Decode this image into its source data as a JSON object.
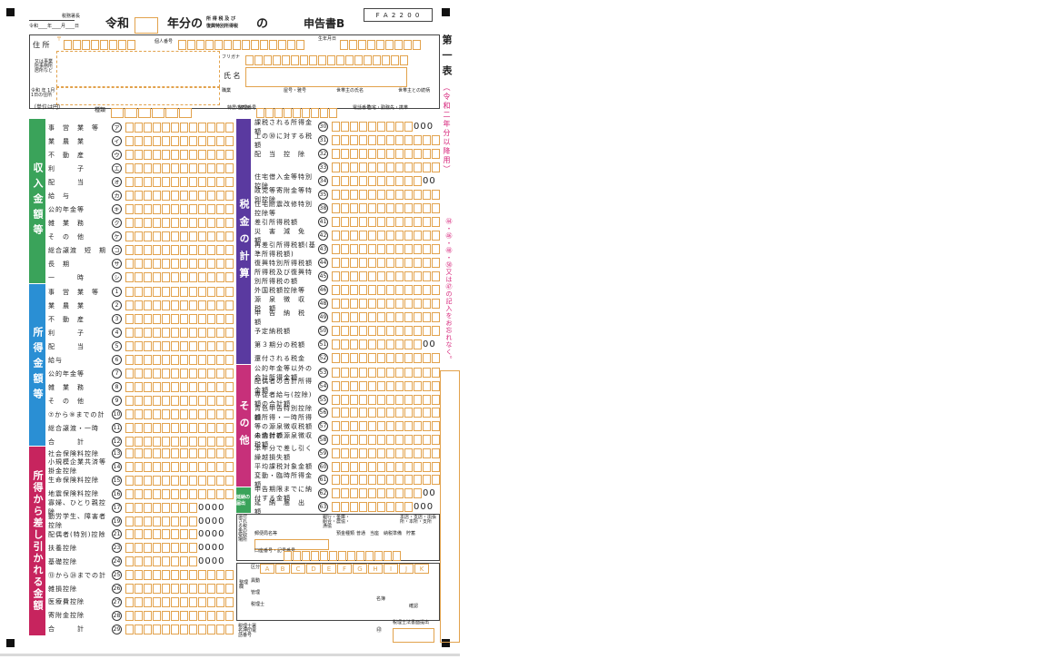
{
  "form": {
    "code_box": "F A 2 2 0 0",
    "tax_office": "税務署長",
    "date_line": "令和____年____月____日",
    "era": "令和",
    "year_suffix": "年分の",
    "tax_kind_line1": "所 得 税 及 び",
    "tax_kind_line2": "復興特別所得税",
    "no": "の",
    "title": "申告書B",
    "side_title": "第一表",
    "side_note": "（令和二年分以降用）",
    "side_warning": "㊹・㊻・㊽・㊿又は㊼の記入をお忘れなく。"
  },
  "header": {
    "address": "住 所",
    "zip_mark": "〒",
    "personal_no": "個人番号",
    "birth": "生年月日",
    "kana": "フリガナ",
    "name": "氏 名",
    "alt_address": "又は事業所事務所居所など",
    "jan1_address": "令和 年 1月1日の住所",
    "occupation": "職業",
    "trade_name": "屋号・雅号",
    "head_name": "世帯主の氏名",
    "relation": "世帯主との続柄",
    "unit": "（単位は円）",
    "kind": "種類",
    "special": "特農の表示",
    "seiri": "整理番号",
    "phone": "電話番号",
    "phone_kind": "自宅・勤務先・携帯"
  },
  "bands": {
    "income_revenue": "収入金額等",
    "income_amount": "所得金額等",
    "deductions": "所得から差し引かれる金額",
    "tax_calc": "税金の計算",
    "other": "その他",
    "extension": "延納の届出"
  },
  "revenue_rows": [
    {
      "label": "事　営　業　等",
      "num": "ア"
    },
    {
      "label": "業　農　業",
      "num": "イ"
    },
    {
      "label": "不　動　産",
      "num": "ウ"
    },
    {
      "label": "利　　　子",
      "num": "エ"
    },
    {
      "label": "配　　　当",
      "num": "オ"
    },
    {
      "label": "給　与",
      "num": "カ"
    },
    {
      "label": "公的年金等",
      "num": "キ"
    },
    {
      "label": "雑　業　務",
      "num": "ク"
    },
    {
      "label": "そ　の　他",
      "num": "ケ"
    },
    {
      "label": "総合譲渡　短　期",
      "num": "コ"
    },
    {
      "label": "長　期",
      "num": "サ"
    },
    {
      "label": "一　　　時",
      "num": "シ"
    }
  ],
  "income_rows": [
    {
      "label": "事　営　業　等",
      "num": "1"
    },
    {
      "label": "業　農　業",
      "num": "2"
    },
    {
      "label": "不　動　産",
      "num": "3"
    },
    {
      "label": "利　　　子",
      "num": "4"
    },
    {
      "label": "配　　　当",
      "num": "5"
    },
    {
      "label": "給与",
      "num": "6"
    },
    {
      "label": "公的年金等",
      "num": "7"
    },
    {
      "label": "雑　業　務",
      "num": "8"
    },
    {
      "label": "そ　の　他",
      "num": "9"
    },
    {
      "label": "⑦から⑨までの計",
      "num": "10"
    },
    {
      "label": "総合譲渡・一時",
      "num": "11"
    },
    {
      "label": "合　　　計",
      "num": "12"
    }
  ],
  "deduction_rows": [
    {
      "label": "社会保険料控除",
      "num": "13",
      "zeros": ""
    },
    {
      "label": "小規模企業共済等掛金控除",
      "num": "14",
      "zeros": ""
    },
    {
      "label": "生命保険料控除",
      "num": "15",
      "zeros": ""
    },
    {
      "label": "地震保険料控除",
      "num": "16",
      "zeros": ""
    },
    {
      "label": "寡婦、ひとり親控除",
      "num": "17",
      "zeros": "0000"
    },
    {
      "label": "勤労学生、障害者控除",
      "num": "19",
      "zeros": "0000"
    },
    {
      "label": "配偶者(特別)控除",
      "num": "21",
      "zeros": "0000"
    },
    {
      "label": "扶養控除",
      "num": "23",
      "zeros": "0000"
    },
    {
      "label": "基礎控除",
      "num": "24",
      "zeros": "0000"
    },
    {
      "label": "⑬から㉔までの計",
      "num": "25",
      "zeros": ""
    },
    {
      "label": "雑損控除",
      "num": "26",
      "zeros": ""
    },
    {
      "label": "医療費控除",
      "num": "27",
      "zeros": ""
    },
    {
      "label": "寄附金控除",
      "num": "28",
      "zeros": ""
    },
    {
      "label": "合　　　計",
      "num": "29",
      "zeros": ""
    }
  ],
  "tax_rows": [
    {
      "label": "課税される所得金額",
      "num": "30",
      "zeros": "000"
    },
    {
      "label": "上の㉚に対する税額",
      "num": "31",
      "zeros": ""
    },
    {
      "label": "配　当　控　除",
      "num": "32",
      "zeros": ""
    },
    {
      "label": "",
      "num": "33",
      "zeros": ""
    },
    {
      "label": "住宅借入金等特別控除",
      "num": "34",
      "zeros": "00"
    },
    {
      "label": "政党等寄附金等特別控除",
      "num": "35",
      "zeros": ""
    },
    {
      "label": "住宅耐震改修特別控除等",
      "num": "38",
      "zeros": ""
    },
    {
      "label": "差引所得税額",
      "num": "41",
      "zeros": ""
    },
    {
      "label": "災　害　減　免　額",
      "num": "42",
      "zeros": ""
    },
    {
      "label": "再差引所得税額(基準所得税額)",
      "num": "43",
      "zeros": ""
    },
    {
      "label": "復興特別所得税額",
      "num": "44",
      "zeros": ""
    },
    {
      "label": "所得税及び復興特別所得税の額",
      "num": "45",
      "zeros": ""
    },
    {
      "label": "外国税額控除等",
      "num": "46",
      "zeros": ""
    },
    {
      "label": "源　泉　徴　収　税　額",
      "num": "48",
      "zeros": ""
    },
    {
      "label": "申　告　納　税　額",
      "num": "49",
      "zeros": ""
    },
    {
      "label": "予定納税額",
      "num": "50",
      "zeros": ""
    },
    {
      "label": "第３期分の税額",
      "num": "51",
      "zeros": "00"
    },
    {
      "label": "還付される税金",
      "num": "52",
      "zeros": ""
    }
  ],
  "other_rows": [
    {
      "label": "公的年金等以外の合計所得金額",
      "num": "53",
      "zeros": ""
    },
    {
      "label": "配偶者の合計所得金額",
      "num": "54",
      "zeros": ""
    },
    {
      "label": "専従者給与(控除)額の合計額",
      "num": "55",
      "zeros": ""
    },
    {
      "label": "青色申告特別控除額",
      "num": "56",
      "zeros": ""
    },
    {
      "label": "雑所得・一時所得等の源泉徴収税額の合計額",
      "num": "57",
      "zeros": ""
    },
    {
      "label": "未納付の源泉徴収税額",
      "num": "58",
      "zeros": ""
    },
    {
      "label": "本年分で差し引く繰越損失額",
      "num": "59",
      "zeros": ""
    },
    {
      "label": "平均課税対象金額",
      "num": "60",
      "zeros": ""
    },
    {
      "label": "変動・臨時所得金額",
      "num": "61",
      "zeros": ""
    },
    {
      "label": "申告期限までに納付する金額",
      "num": "62",
      "zeros": "00"
    },
    {
      "label": "延　納　届　出　額",
      "num": "63",
      "zeros": "000"
    }
  ],
  "refund": {
    "title": "還付される税金の受取場所",
    "bank": "銀行・金庫・組合・農協・漁協",
    "branch": "本店・支店・出張所・本所・支所",
    "postal": "郵便局名等",
    "deposit": "預金種類",
    "deposit_kinds": "普通　当座　納税準備　貯蓄",
    "account": "口座番号・記号番号"
  },
  "admin": {
    "area": "区分",
    "letters": [
      "A",
      "B",
      "C",
      "D",
      "E",
      "F",
      "G",
      "H",
      "I",
      "J",
      "K"
    ],
    "column_label": "整理欄",
    "exclusion": "異動",
    "management": "管理",
    "tax_accountant": "税理士",
    "confirm": "確認",
    "name_label": "名簿"
  },
  "footer": {
    "tax_accountant_sign": "税理士署名押印電話番号",
    "seal": "㊞",
    "tax_accountant_law": "税理士法書面提出"
  }
}
